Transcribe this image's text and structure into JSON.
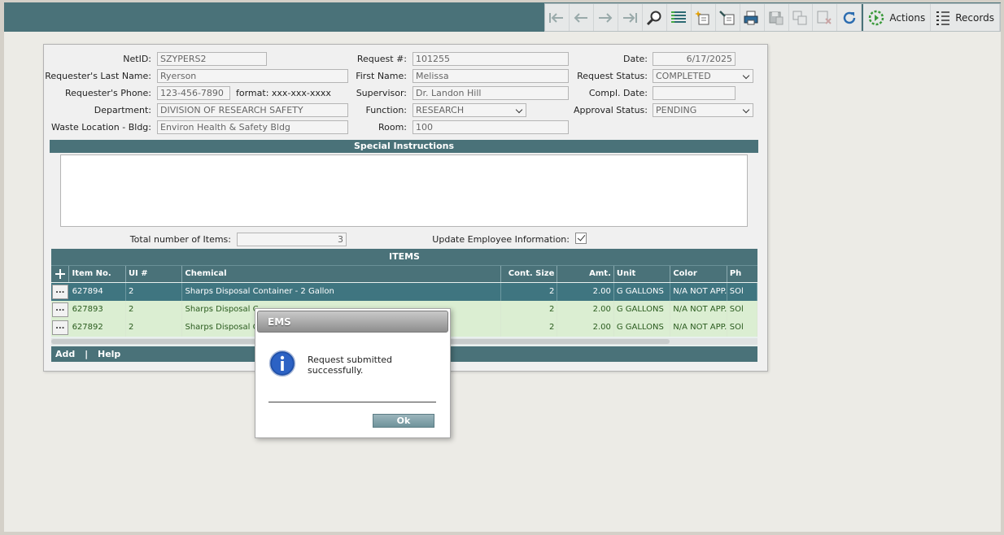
{
  "toolbar": {
    "icons": [
      "first-record-icon",
      "previous-record-icon",
      "next-record-icon",
      "last-record-icon",
      "search-icon",
      "list-view-icon",
      "new-record-icon",
      "edit-record-icon",
      "print-icon",
      "save-icon",
      "copy-icon",
      "delete-icon",
      "refresh-icon"
    ],
    "actions_label": "Actions",
    "records_label": "Records"
  },
  "form": {
    "netid": {
      "label": "NetID:",
      "value": "SZYPERS2"
    },
    "request_no": {
      "label": "Request #:",
      "value": "101255"
    },
    "date": {
      "label": "Date:",
      "value": "6/17/2025"
    },
    "last_name": {
      "label": "Requester's Last Name:",
      "value": "Ryerson"
    },
    "first_name": {
      "label": "First Name:",
      "value": "Melissa"
    },
    "request_status": {
      "label": "Request Status:",
      "value": "COMPLETED"
    },
    "phone": {
      "label": "Requester's Phone:",
      "value": "123-456-7890",
      "format": "format: xxx-xxx-xxxx"
    },
    "supervisor": {
      "label": "Supervisor:",
      "value": "Dr. Landon Hill"
    },
    "compl_date": {
      "label": "Compl. Date:",
      "value": ""
    },
    "department": {
      "label": "Department:",
      "value": "DIVISION OF RESEARCH SAFETY"
    },
    "function": {
      "label": "Function:",
      "value": "RESEARCH"
    },
    "approval_status": {
      "label": "Approval Status:",
      "value": "PENDING"
    },
    "waste_location": {
      "label": "Waste Location - Bldg:",
      "value": "Environ Health & Safety Bldg"
    },
    "room": {
      "label": "Room:",
      "value": "100"
    },
    "special_instructions_title": "Special Instructions",
    "special_instructions_value": "",
    "total_items": {
      "label": "Total number of Items:",
      "value": "3"
    },
    "update_employee": {
      "label": "Update Employee Information:",
      "checked": true
    }
  },
  "items": {
    "title": "ITEMS",
    "add_icon": "plus-icon",
    "columns": [
      "Item No.",
      "UI #",
      "Chemical",
      "Cont. Size",
      "Amt.",
      "Unit",
      "Color",
      "Ph"
    ],
    "rows": [
      {
        "btn": "...",
        "item_no": "627894",
        "ui": "2",
        "chemical": "Sharps Disposal Container - 2 Gallon",
        "cont_size": "2",
        "amt": "2.00",
        "unit": "G GALLONS",
        "color": "N/A NOT APP...",
        "ph": "SOl"
      },
      {
        "btn": "...",
        "item_no": "627893",
        "ui": "2",
        "chemical": "Sharps Disposal C",
        "cont_size": "2",
        "amt": "2.00",
        "unit": "G GALLONS",
        "color": "N/A NOT APP...",
        "ph": "SOl"
      },
      {
        "btn": "...",
        "item_no": "627892",
        "ui": "2",
        "chemical": "Sharps Disposal C",
        "cont_size": "2",
        "amt": "2.00",
        "unit": "G GALLONS",
        "color": "N/A NOT APP...",
        "ph": "SOl"
      }
    ],
    "footer_add": "Add",
    "footer_sep": "|",
    "footer_help": "Help"
  },
  "dialog": {
    "title": "EMS",
    "icon": "info-icon",
    "message": "Request submitted successfully.",
    "ok_label": "Ok"
  }
}
